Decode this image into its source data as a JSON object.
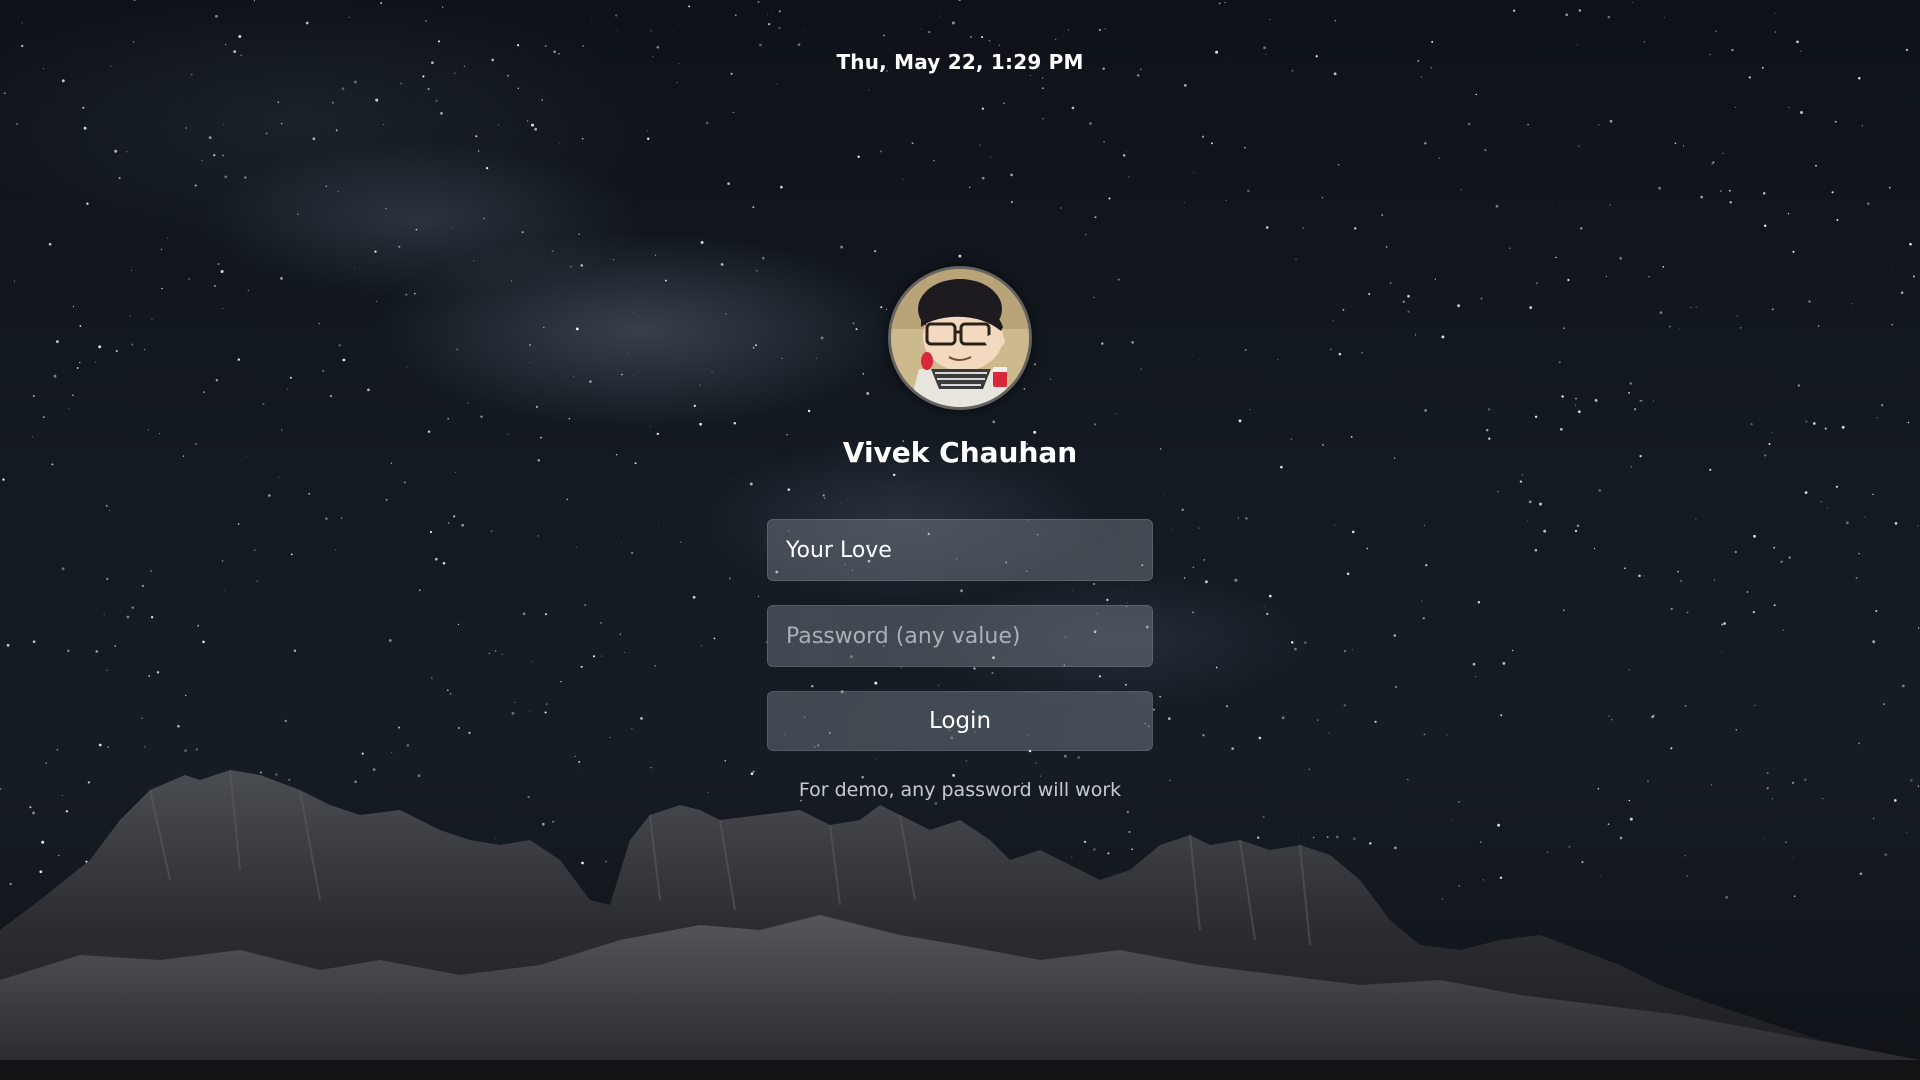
{
  "lock_screen": {
    "datetime": "Thu, May 22, 1:29 PM",
    "user": {
      "name": "Vivek Chauhan",
      "avatar_icon": "cartoon-avatar-icon"
    },
    "form": {
      "username_value": "Your Love",
      "password_placeholder": "Password (any value)",
      "login_label": "Login",
      "hint": "For demo, any password will work"
    }
  },
  "colors": {
    "sky_dark": "#0e1218",
    "text": "#ffffff",
    "field_bg": "#6f7780"
  }
}
